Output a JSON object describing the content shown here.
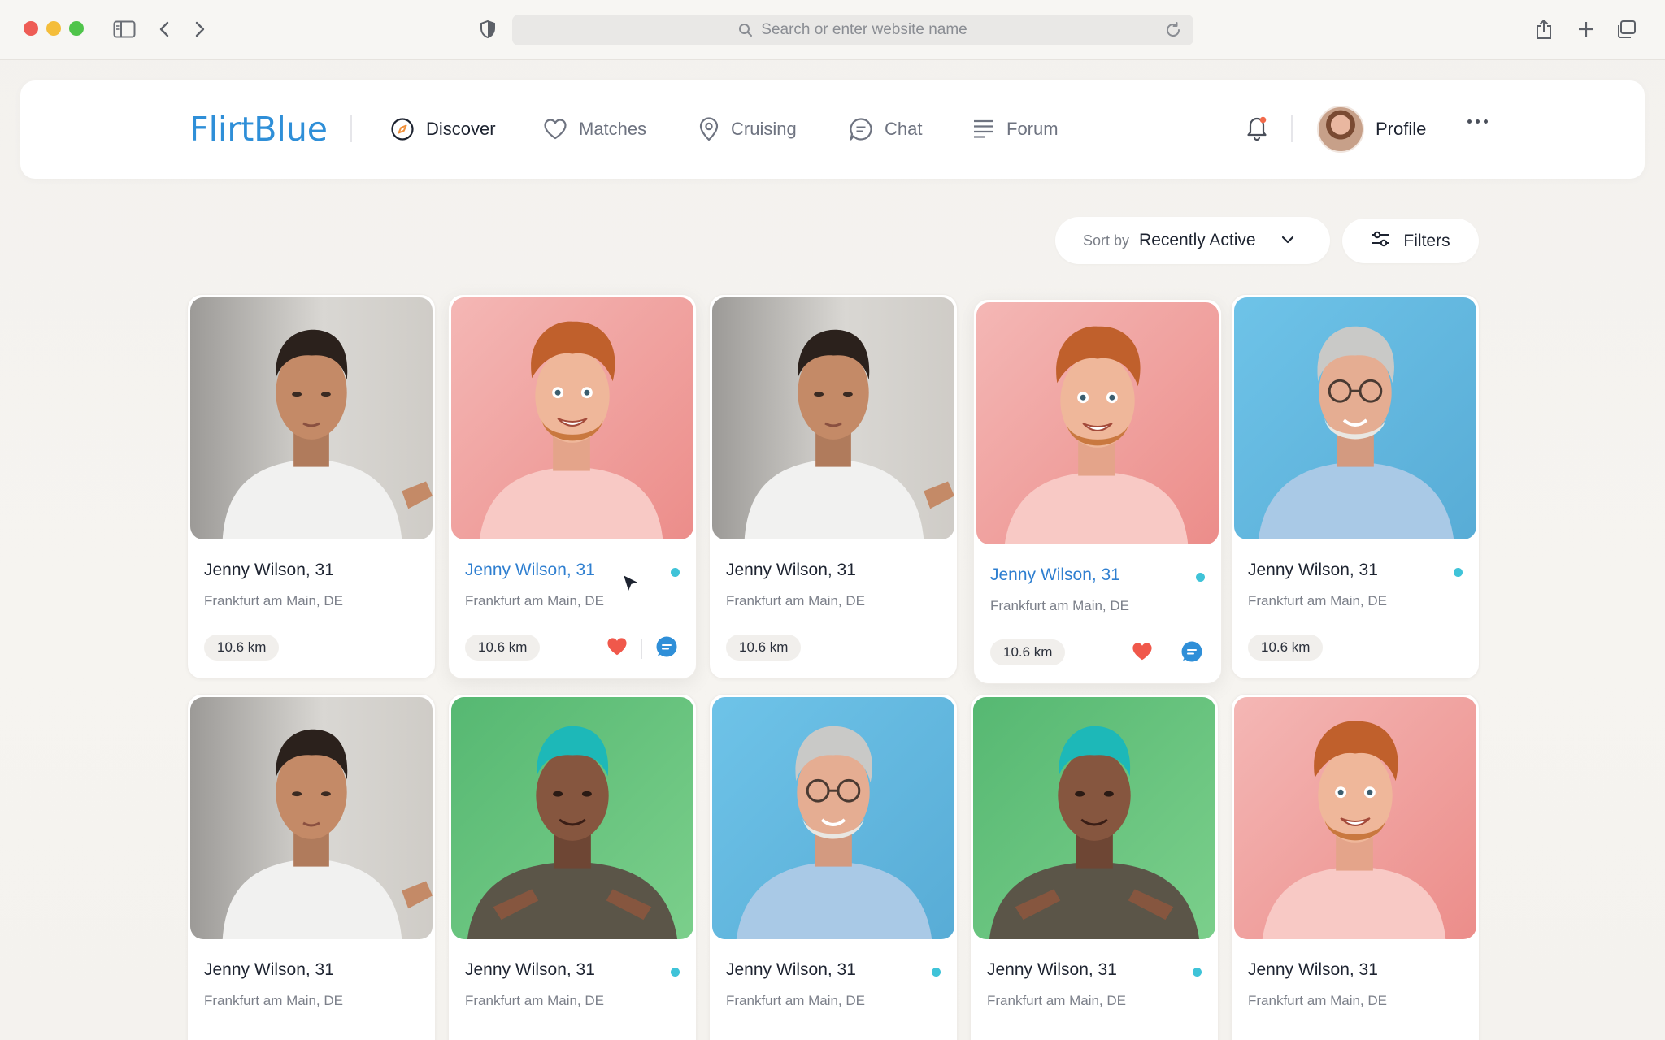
{
  "browser": {
    "url_placeholder": "Search or enter website name"
  },
  "app": {
    "logo": "FlirtBlue",
    "nav": [
      {
        "label": "Discover",
        "icon": "compass-icon",
        "active": true
      },
      {
        "label": "Matches",
        "icon": "heart-icon",
        "active": false
      },
      {
        "label": "Cruising",
        "icon": "location-pin-icon",
        "active": false
      },
      {
        "label": "Chat",
        "icon": "chat-bubble-icon",
        "active": false
      },
      {
        "label": "Forum",
        "icon": "forum-lines-icon",
        "active": false
      }
    ],
    "profile_label": "Profile"
  },
  "sort": {
    "label": "Sort by",
    "value": "Recently Active"
  },
  "filters_label": "Filters",
  "colors": {
    "accent": "#2f8fd8",
    "online": "#3fc3d8",
    "like": "#f0584b",
    "chat": "#2f8fd8"
  },
  "cards": [
    {
      "name": "Jenny Wilson, 31",
      "location": "Frankfurt am Main, DE",
      "distance": "10.6 km",
      "online": false,
      "photo": "man-white-tee-grey-bg"
    },
    {
      "name": "Jenny Wilson, 31",
      "location": "Frankfurt am Main, DE",
      "distance": "10.6 km",
      "online": true,
      "photo": "redhead-pink-bg",
      "hover": true
    },
    {
      "name": "Jenny Wilson, 31",
      "location": "Frankfurt am Main, DE",
      "distance": "10.6 km",
      "online": false,
      "photo": "man-white-tee-grey-bg"
    },
    {
      "name": "Jenny Wilson, 31",
      "location": "Frankfurt am Main, DE",
      "distance": "10.6 km",
      "online": true,
      "photo": "redhead-pink-bg",
      "hover": true
    },
    {
      "name": "Jenny Wilson, 31",
      "location": "Frankfurt am Main, DE",
      "distance": "10.6 km",
      "online": true,
      "photo": "older-man-blue-bg"
    },
    {
      "name": "Jenny Wilson, 31",
      "location": "Frankfurt am Main, DE",
      "online": false,
      "photo": "man-white-tee-grey-bg"
    },
    {
      "name": "Jenny Wilson, 31",
      "location": "Frankfurt am Main, DE",
      "online": true,
      "photo": "teal-hair-green-bg"
    },
    {
      "name": "Jenny Wilson, 31",
      "location": "Frankfurt am Main, DE",
      "online": true,
      "photo": "older-man-blue-bg"
    },
    {
      "name": "Jenny Wilson, 31",
      "location": "Frankfurt am Main, DE",
      "online": true,
      "photo": "teal-hair-green-bg"
    },
    {
      "name": "Jenny Wilson, 31",
      "location": "Frankfurt am Main, DE",
      "online": false,
      "photo": "redhead-pink-bg"
    }
  ]
}
